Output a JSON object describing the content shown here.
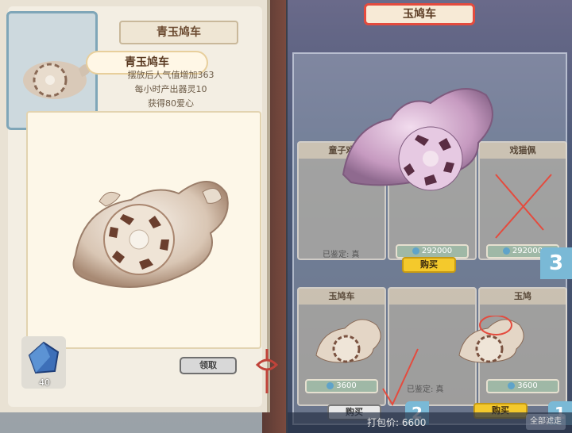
{
  "left": {
    "title": "青玉鸠车",
    "ribbon_name": "青玉鸠车",
    "info_lines": [
      "摆放后人气值增加363",
      "每小时产出器灵10",
      "获得80爱心"
    ],
    "claim_button": "领取",
    "gem_count": "40"
  },
  "right": {
    "tab_title": "玉鸠车",
    "cards_top": [
      {
        "head": "童子戏",
        "identified": "已鉴定: 真"
      },
      {
        "head": "",
        "price": "292000",
        "buy": "购买"
      },
      {
        "head": "戏猫佩",
        "price": "292000"
      }
    ],
    "cards_bottom": [
      {
        "head": "玉鸠车",
        "price": "3600",
        "buy": "购买"
      },
      {
        "head": "",
        "identified": "已鉴定: 真"
      },
      {
        "head": "玉鸠",
        "price": "3600",
        "buy": "购买"
      }
    ],
    "steps": [
      "3",
      "2",
      "1"
    ],
    "bottom_label": "打包价: 6600",
    "all_button": "全部滤走"
  },
  "colors": {
    "accent_yellow": "#f4c92c",
    "step_blue": "#7ab9d6",
    "red_mark": "#e44b3e"
  }
}
